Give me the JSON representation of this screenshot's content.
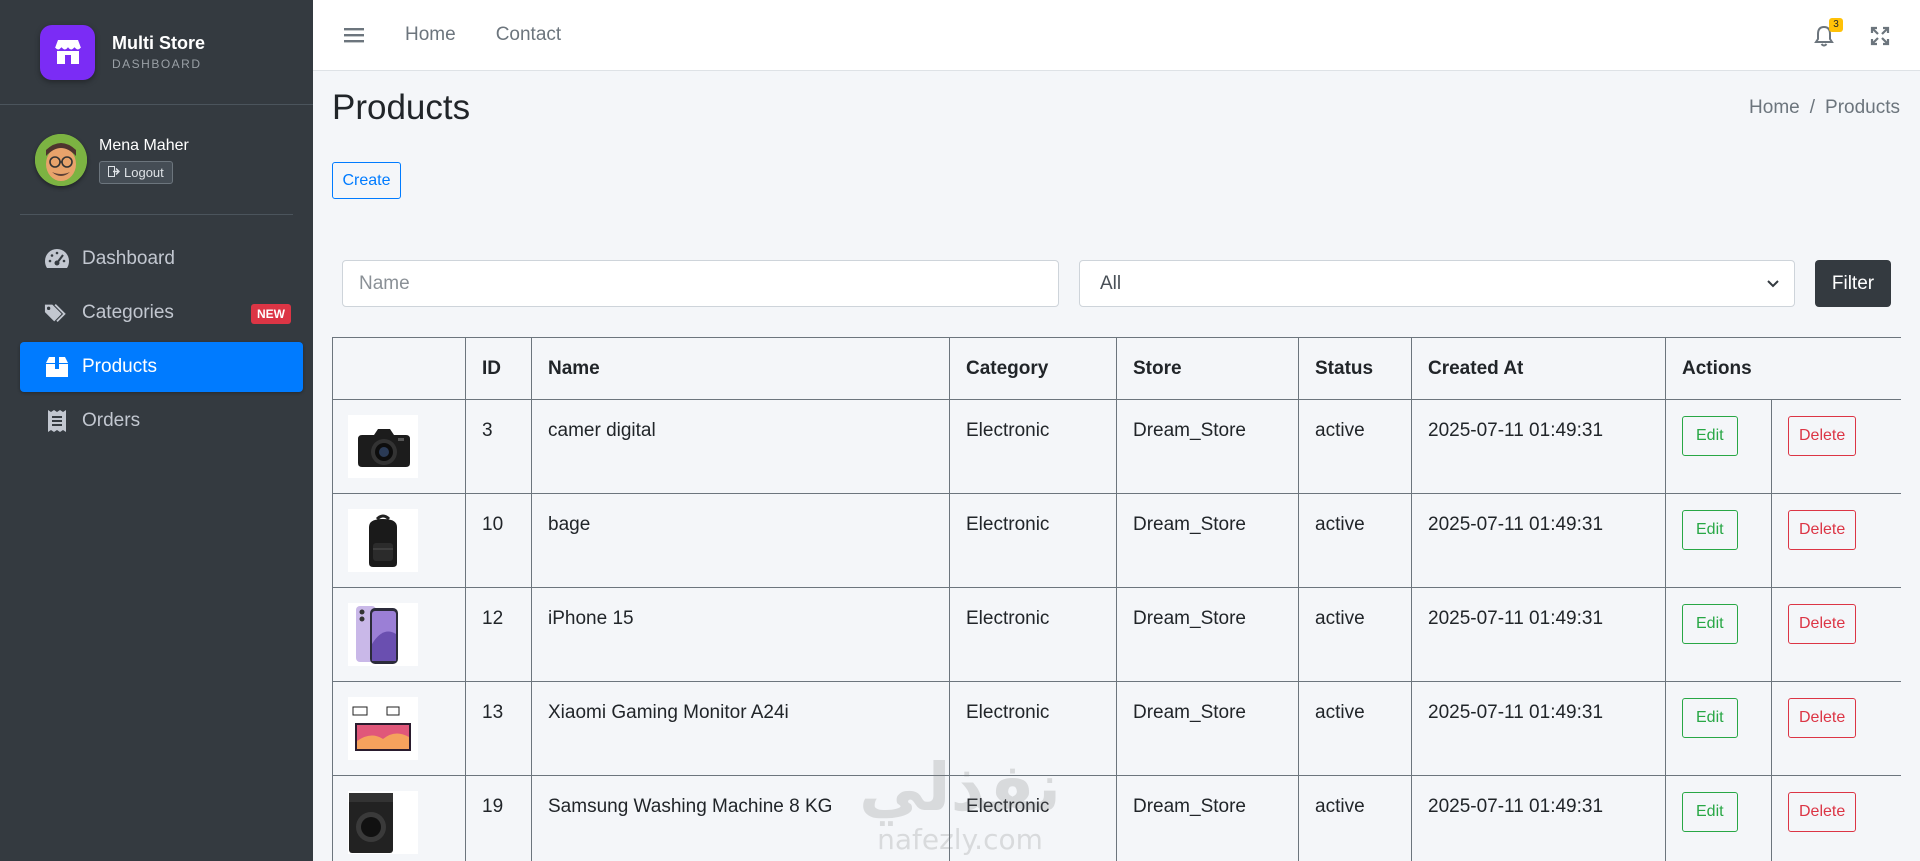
{
  "brand": {
    "title": "Multi Store",
    "subtitle": "DASHBOARD"
  },
  "user": {
    "name": "Mena Maher",
    "logout_label": "Logout"
  },
  "sidebar": {
    "items": [
      {
        "label": "Dashboard",
        "icon": "tachometer-icon",
        "active": false
      },
      {
        "label": "Categories",
        "icon": "tags-icon",
        "active": false,
        "badge": "NEW"
      },
      {
        "label": "Products",
        "icon": "box-icon",
        "active": true
      },
      {
        "label": "Orders",
        "icon": "receipt-icon",
        "active": false
      }
    ]
  },
  "topbar": {
    "links": [
      "Home",
      "Contact"
    ],
    "notifications_count": "3"
  },
  "page": {
    "title": "Products",
    "breadcrumb": {
      "home": "Home",
      "separator": "/",
      "current": "Products"
    },
    "create_label": "Create"
  },
  "filters": {
    "name_placeholder": "Name",
    "status_selected": "All",
    "filter_label": "Filter"
  },
  "table": {
    "headers": [
      "",
      "ID",
      "Name",
      "Category",
      "Store",
      "Status",
      "Created At",
      "Actions"
    ],
    "edit_label": "Edit",
    "delete_label": "Delete",
    "rows": [
      {
        "thumb": "camera",
        "id": "3",
        "name": "camer digital",
        "category": "Electronic",
        "store": "Dream_Store",
        "status": "active",
        "created_at": "2025-07-11 01:49:31"
      },
      {
        "thumb": "backpack",
        "id": "10",
        "name": "bage",
        "category": "Electronic",
        "store": "Dream_Store",
        "status": "active",
        "created_at": "2025-07-11 01:49:31"
      },
      {
        "thumb": "phone",
        "id": "12",
        "name": "iPhone 15",
        "category": "Electronic",
        "store": "Dream_Store",
        "status": "active",
        "created_at": "2025-07-11 01:49:31"
      },
      {
        "thumb": "monitor",
        "id": "13",
        "name": "Xiaomi Gaming Monitor A24i",
        "category": "Electronic",
        "store": "Dream_Store",
        "status": "active",
        "created_at": "2025-07-11 01:49:31"
      },
      {
        "thumb": "washer",
        "id": "19",
        "name": "Samsung Washing Machine 8 KG",
        "category": "Electronic",
        "store": "Dream_Store",
        "status": "active",
        "created_at": "2025-07-11 01:49:31"
      }
    ]
  },
  "watermark": {
    "arabic": "نفذلي",
    "latin": "nafezly.com"
  },
  "colors": {
    "sidebar_bg": "#343a40",
    "active_nav": "#007bff",
    "brand_logo": "#7b2cf5",
    "edit": "#28a745",
    "delete": "#dc3545",
    "badge_new": "#dc3545",
    "bell_badge": "#ffc107"
  }
}
